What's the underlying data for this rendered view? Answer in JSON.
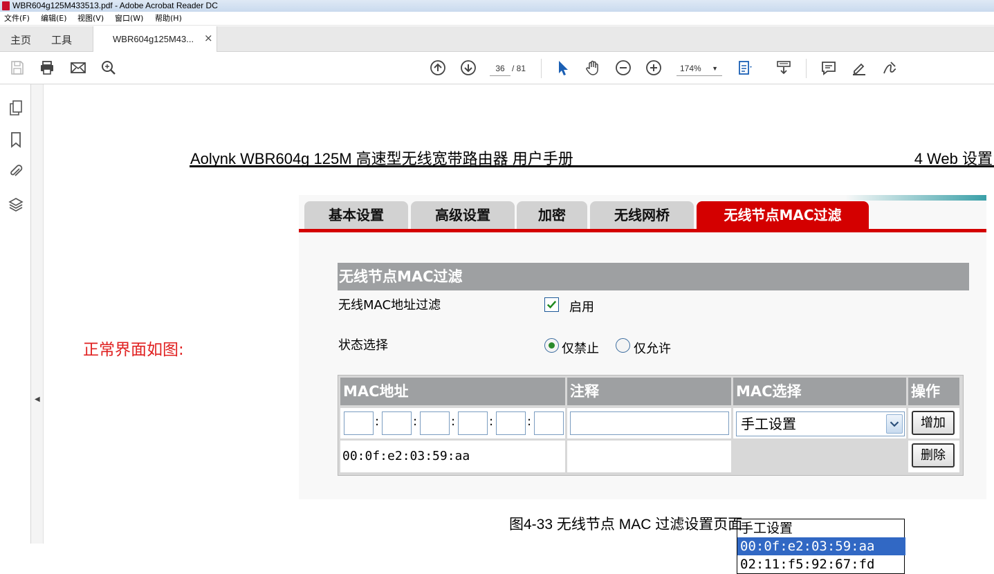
{
  "window": {
    "title": "WBR604g125M433513.pdf - Adobe Acrobat Reader DC"
  },
  "menu": {
    "items": [
      "文件(F)",
      "编辑(E)",
      "视图(V)",
      "窗口(W)",
      "帮助(H)"
    ]
  },
  "tabs": {
    "home": "主页",
    "tools": "工具",
    "doc": "WBR604g125M43...",
    "close": "×"
  },
  "toolbar": {
    "page_current": "36",
    "page_total": "/ 81",
    "zoom": "174%",
    "icons": [
      "save-icon",
      "print-icon",
      "mail-icon",
      "search-icon",
      "page-up-icon",
      "page-down-icon",
      "select-arrow-icon",
      "hand-icon",
      "zoom-out-icon",
      "zoom-in-icon",
      "fit-page-icon",
      "scroll-mode-icon",
      "comment-icon",
      "highlight-icon",
      "sign-icon"
    ]
  },
  "sidebar": {
    "icons": [
      "pages-icon",
      "bookmark-icon",
      "attachment-icon",
      "layers-icon"
    ]
  },
  "document": {
    "header_left": "Aolynk WBR604g 125M 高速型无线宽带路由器  用户手册",
    "header_right": "4  Web 设置",
    "note": "正常界面如图:",
    "caption": "图4-33  无线节点 MAC 过滤设置页面"
  },
  "router_ui": {
    "tabs": [
      "基本设置",
      "高级设置",
      "加密",
      "无线网桥",
      "无线节点MAC过滤"
    ],
    "active_tab": 4,
    "section_title": "无线节点MAC过滤",
    "filter_label": "无线MAC地址过滤",
    "enable_label": "启用",
    "enable_checked": true,
    "state_label": "状态选择",
    "radio_deny": "仅禁止",
    "radio_allow": "仅允许",
    "radio_selected": "deny",
    "table": {
      "headers": [
        "MAC地址",
        "注释",
        "MAC选择",
        "操作"
      ],
      "select_value": "手工设置",
      "add_button": "增加",
      "delete_button": "删除",
      "row_mac": "00:0f:e2:03:59:aa"
    },
    "dropdown_options": [
      "手工设置",
      "00:0f:e2:03:59:aa",
      "02:11:f5:92:67:fd"
    ],
    "dropdown_highlighted": 1,
    "colors": {
      "accent": "#d40000",
      "header_gray": "#9ea0a2",
      "highlight": "#3168c4"
    }
  }
}
